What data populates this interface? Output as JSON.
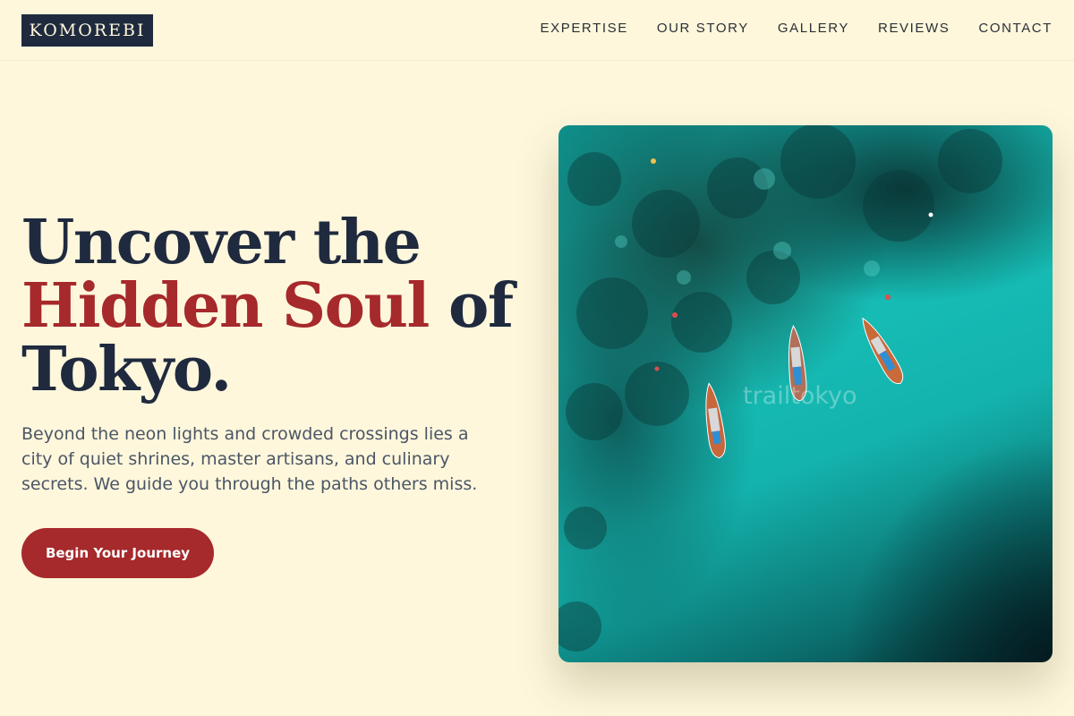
{
  "brand": {
    "logo_text": "KOMOREBI"
  },
  "nav": {
    "items": [
      {
        "label": "EXPERTISE"
      },
      {
        "label": "OUR STORY"
      },
      {
        "label": "GALLERY"
      },
      {
        "label": "REVIEWS"
      },
      {
        "label": "CONTACT"
      }
    ]
  },
  "hero": {
    "headline_part1": "Uncover the",
    "headline_accent": "Hidden Soul",
    "headline_part2": "of",
    "headline_part3": "Tokyo.",
    "lead": "Beyond the neon lights and crowded crossings lies a city of quiet shrines, master artisans, and culinary secrets. We guide you through the paths others miss.",
    "cta_label": "Begin Your Journey",
    "image_watermark": "trailtokyo"
  },
  "colors": {
    "background": "#fef7dc",
    "navy": "#1f2a3e",
    "accent_red": "#a6292b",
    "body_text": "#4b5566"
  }
}
